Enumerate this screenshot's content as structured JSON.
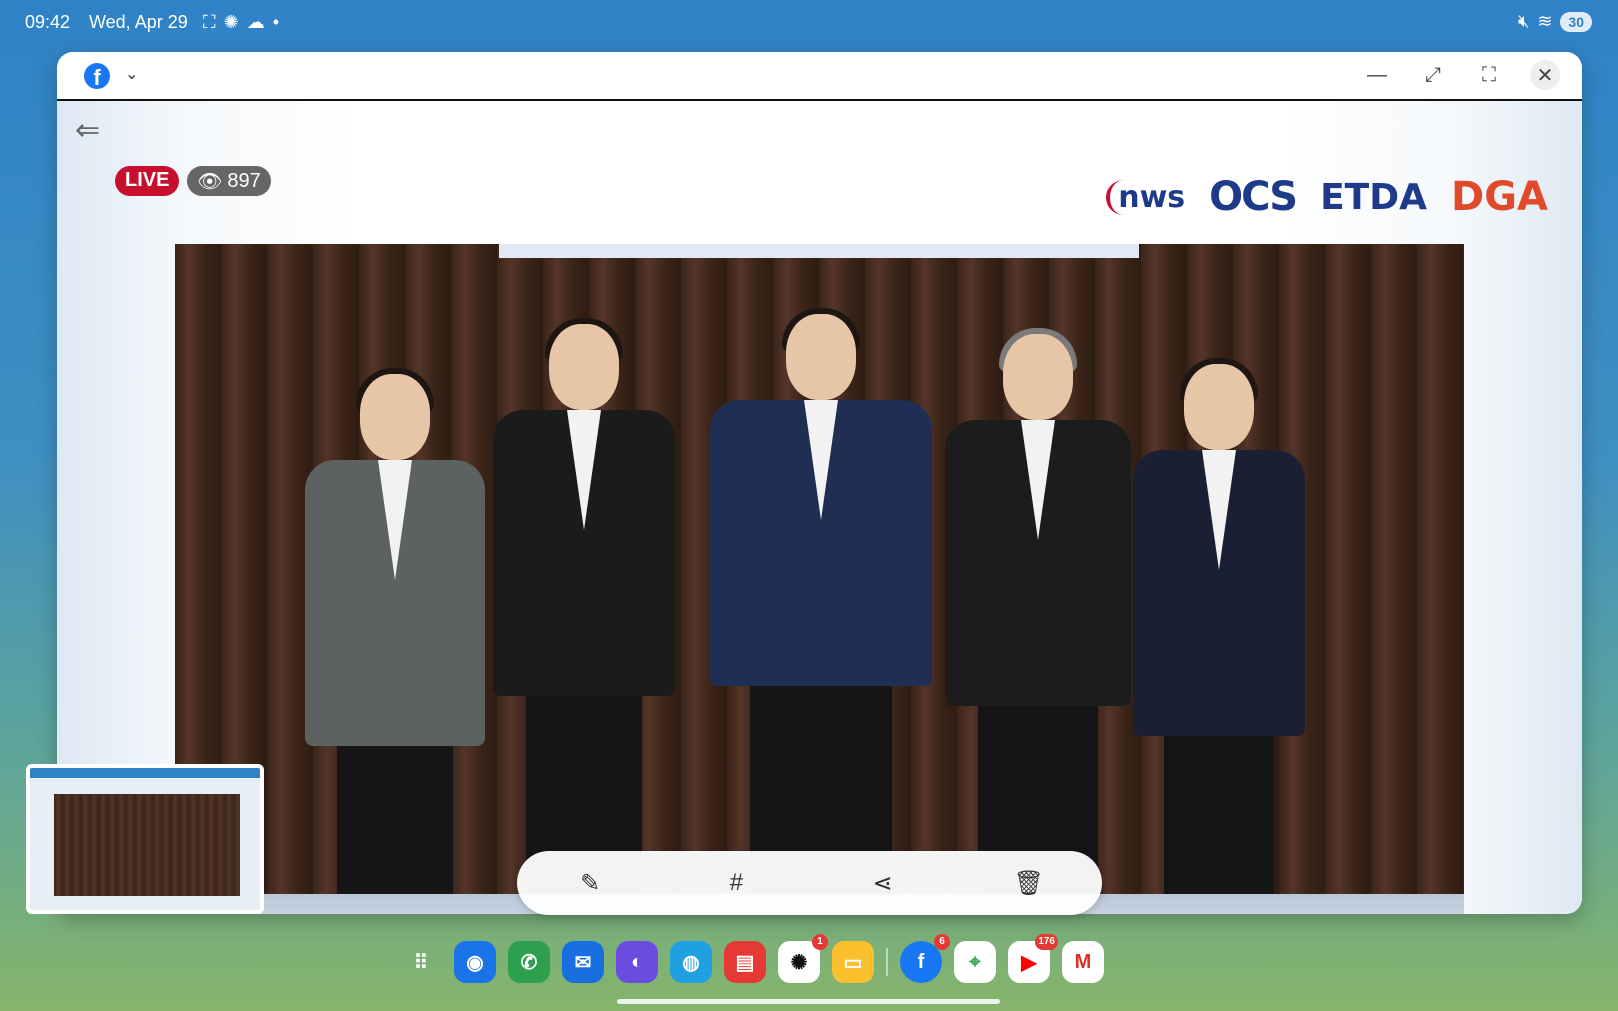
{
  "status_bar": {
    "time": "09:42",
    "date": "Wed, Apr 29",
    "battery": "30",
    "icons": [
      "screenshot-icon",
      "chatgpt-icon",
      "cloud-icon",
      "dot-icon",
      "mute-icon",
      "wifi-icon"
    ]
  },
  "window": {
    "app": "Facebook",
    "controls": [
      "minimize-icon",
      "resize-icon",
      "fullscreen-icon",
      "close-icon"
    ]
  },
  "live": {
    "badge": "LIVE",
    "viewers": "897"
  },
  "sponsors": [
    "nws",
    "OCS",
    "ETDA",
    "DGA"
  ],
  "toolbar": {
    "tools": [
      "edit-icon",
      "hashtag-icon",
      "share-icon",
      "delete-icon"
    ],
    "hash_label": "#"
  },
  "dock": {
    "apps": [
      {
        "name": "app-drawer",
        "color": "transparent",
        "glyph": "⋮⋮"
      },
      {
        "name": "location-app",
        "color": "#1a73e8",
        "glyph": "◉"
      },
      {
        "name": "phone-app",
        "color": "#2e9e4f",
        "glyph": "✆"
      },
      {
        "name": "messages-app",
        "color": "#1a6fe0",
        "glyph": "✉"
      },
      {
        "name": "browser-app",
        "color": "#6a4de0",
        "glyph": "◐"
      },
      {
        "name": "bixby-app",
        "color": "#1fa0e0",
        "glyph": "◍"
      },
      {
        "name": "notes-app",
        "color": "#e53935",
        "glyph": "▤"
      },
      {
        "name": "chatgpt-app",
        "color": "#ffffff",
        "glyph": "✺",
        "badge": "1"
      },
      {
        "name": "files-app",
        "color": "#fbc02d",
        "glyph": "▭"
      },
      {
        "name": "facebook-app",
        "color": "#1877f2",
        "glyph": "f",
        "badge": "6"
      },
      {
        "name": "maps-app",
        "color": "#ffffff",
        "glyph": "⌖"
      },
      {
        "name": "youtube-app",
        "color": "#ff0000",
        "glyph": "▶",
        "badge": "176"
      },
      {
        "name": "gmail-app",
        "color": "#ffffff",
        "glyph": "M"
      }
    ]
  },
  "colors": {
    "live_red": "#c8102e",
    "facebook_blue": "#1877f2"
  }
}
